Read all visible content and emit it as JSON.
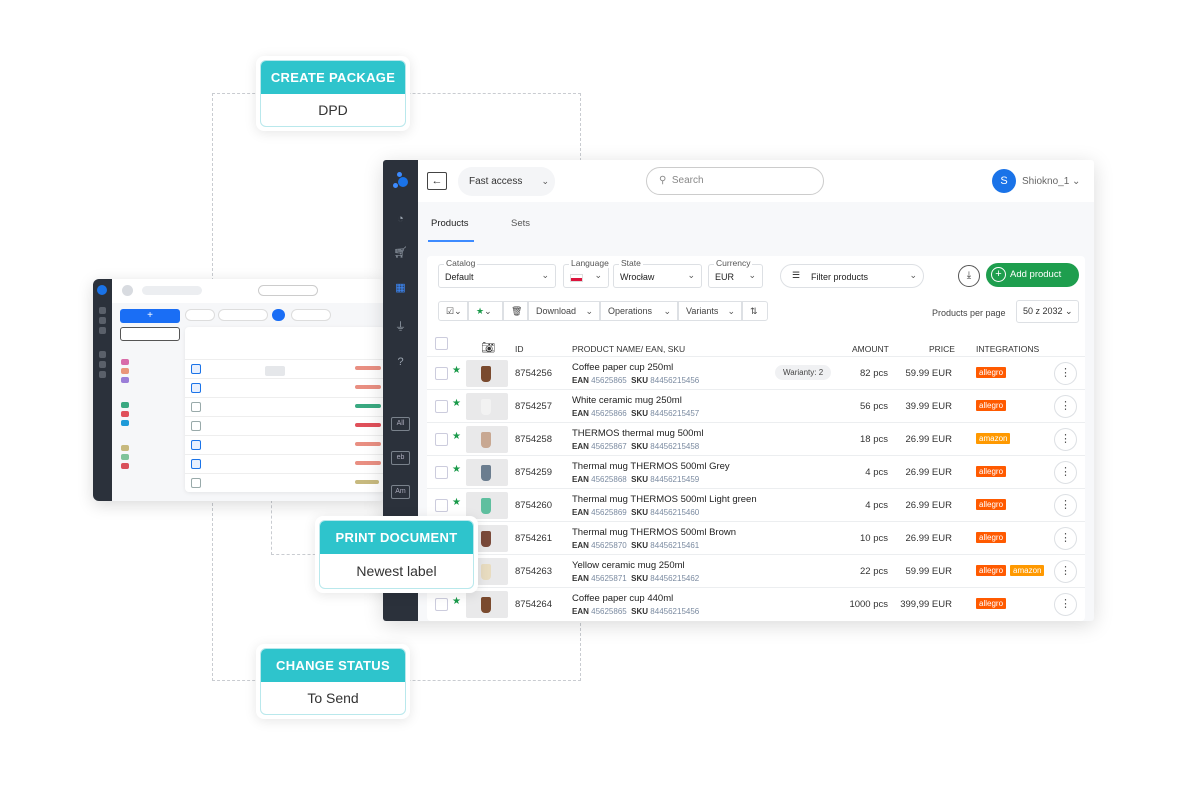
{
  "callouts": [
    {
      "title": "CREATE PACKAGE",
      "value": "DPD"
    },
    {
      "title": "PRINT DOCUMENT",
      "value": "Newest label"
    },
    {
      "title": "CHANGE STATUS",
      "value": "To Send"
    }
  ],
  "colors": {
    "accent": "#2ec4cc",
    "brand": "#1a73e8",
    "add": "#1e9e4e",
    "allegro": "#ff5a00",
    "amazon": "#ff9900"
  },
  "header": {
    "fast_access": "Fast access",
    "search_placeholder": "Search",
    "avatar_initial": "S",
    "user": "Shiokno_1"
  },
  "tabs": [
    {
      "label": "Products",
      "active": true
    },
    {
      "label": "Sets"
    }
  ],
  "sidebar_tags": [
    "All",
    "eb",
    "Am"
  ],
  "filters": {
    "catalog": {
      "label": "Catalog",
      "value": "Default"
    },
    "language": {
      "label": "Language"
    },
    "state": {
      "label": "State",
      "value": "Wrocław"
    },
    "currency": {
      "label": "Currency",
      "value": "EUR"
    },
    "filter_products": "Filter products",
    "add_product": "Add product"
  },
  "toolbar": {
    "download": "Download",
    "operations": "Operations",
    "variants": "Variants",
    "per_page_label": "Products per page",
    "per_page": "50 z 2032"
  },
  "columns": {
    "id": "ID",
    "name": "PRODUCT NAME/ EAN, SKU",
    "amount": "AMOUNT",
    "price": "PRICE",
    "integrations": "INTEGRATIONS"
  },
  "products": [
    {
      "id": "8754256",
      "name": "Coffee paper cup 250ml",
      "ean": "45625865",
      "sku": "84456215456",
      "variants": "Warianty: 2",
      "amount": "82 pcs",
      "price": "59.99 EUR",
      "integrations": [
        "allegro"
      ],
      "color": "#7a4a2e"
    },
    {
      "id": "8754257",
      "name": "White ceramic mug 250ml",
      "ean": "45625866",
      "sku": "84456215457",
      "amount": "56 pcs",
      "price": "39.99 EUR",
      "integrations": [
        "allegro"
      ],
      "color": "#f2f2f2"
    },
    {
      "id": "8754258",
      "name": "THERMOS thermal mug 500ml",
      "ean": "45625867",
      "sku": "84456215458",
      "amount": "18 pcs",
      "price": "26.99 EUR",
      "integrations": [
        "amazon"
      ],
      "color": "#c8a892"
    },
    {
      "id": "8754259",
      "name": "Thermal mug THERMOS 500ml Grey",
      "ean": "45625868",
      "sku": "84456215459",
      "amount": "4 pcs",
      "price": "26.99 EUR",
      "integrations": [
        "allegro"
      ],
      "color": "#6b7d8f"
    },
    {
      "id": "8754260",
      "name": "Thermal mug THERMOS 500ml Light green",
      "ean": "45625869",
      "sku": "84456215460",
      "amount": "4 pcs",
      "price": "26.99 EUR",
      "integrations": [
        "allegro"
      ],
      "color": "#5fbf9f"
    },
    {
      "id": "8754261",
      "name": "Thermal mug THERMOS 500ml Brown",
      "ean": "45625870",
      "sku": "84456215461",
      "amount": "10 pcs",
      "price": "26.99 EUR",
      "integrations": [
        "allegro"
      ],
      "color": "#7a4a3a"
    },
    {
      "id": "8754263",
      "name": "Yellow ceramic mug 250ml",
      "ean": "45625871",
      "sku": "84456215462",
      "amount": "22 pcs",
      "price": "59.99 EUR",
      "integrations": [
        "allegro",
        "amazon"
      ],
      "color": "#e8dcc0"
    },
    {
      "id": "8754264",
      "name": "Coffee paper cup 440ml",
      "ean": "45625865",
      "sku": "84456215456",
      "amount": "1000 pcs",
      "price": "399,99 EUR",
      "integrations": [
        "allegro"
      ],
      "color": "#7a4a2e"
    }
  ],
  "labels": {
    "ean": "EAN",
    "sku": "SKU"
  }
}
